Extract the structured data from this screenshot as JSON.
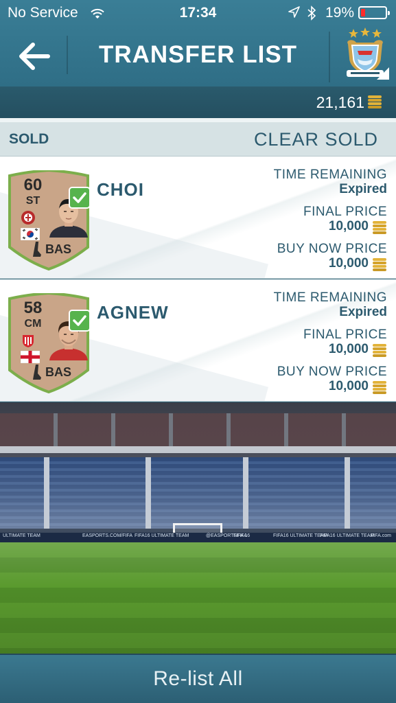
{
  "status_bar": {
    "carrier": "No Service",
    "time": "17:34",
    "battery_percent": "19%",
    "battery_level": 0.19,
    "battery_color": "#ff2b2b"
  },
  "header": {
    "title": "TRANSFER LIST",
    "back_icon": "back-arrow-icon",
    "club_badge": "manchester-city-crest"
  },
  "coins": {
    "amount": "21,161",
    "icon": "coins-icon"
  },
  "section": {
    "label": "SOLD",
    "clear_label": "CLEAR SOLD"
  },
  "labels": {
    "time_remaining": "TIME REMAINING",
    "final_price": "FINAL PRICE",
    "buy_now_price": "BUY NOW PRICE"
  },
  "items": [
    {
      "name": "CHOI",
      "rating": "60",
      "position": "ST",
      "chemistry_style": "BAS",
      "nation": "South Korea",
      "time_remaining": "Expired",
      "final_price": "10,000",
      "buy_now_price": "10,000"
    },
    {
      "name": "AGNEW",
      "rating": "58",
      "position": "CM",
      "chemistry_style": "BAS",
      "nation": "England",
      "time_remaining": "Expired",
      "final_price": "10,000",
      "buy_now_price": "10,000"
    }
  ],
  "stadium_ads": [
    "ULTIMATE TEAM",
    "EASPORTS.COM/FIFA",
    "FIFA16 ULTIMATE TEAM",
    "@EASPORTSFIFA",
    "FIFA 16",
    "FIFA16 ULTIMATE TEAM",
    "FIFA16 ULTIMATE TEAM",
    "FIFA.com"
  ],
  "relist_button": "Re-list All",
  "colors": {
    "header": "#3a7e96",
    "text_primary": "#2c5a6e",
    "card_gold": "#c9a588",
    "card_border": "#7cae4b",
    "check_green": "#57b34d"
  }
}
